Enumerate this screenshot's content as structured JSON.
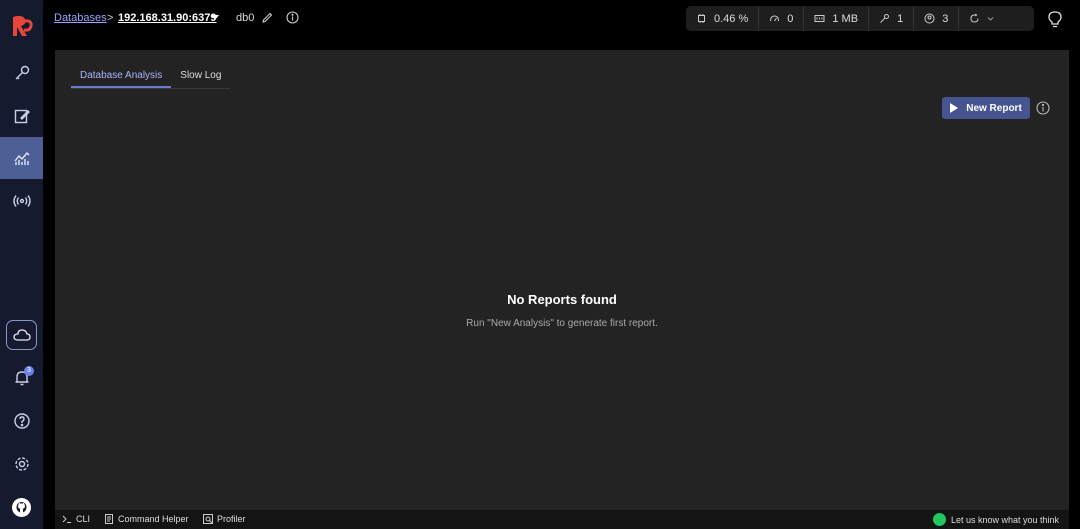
{
  "sidebar": {
    "logo": "redis-insight-logo",
    "items": [
      {
        "icon": "key-icon"
      },
      {
        "icon": "edit-icon"
      },
      {
        "icon": "analytics-icon",
        "active": true
      },
      {
        "icon": "pubsub-icon"
      }
    ],
    "notifications_count": "3"
  },
  "header": {
    "breadcrumb_link": "Databases",
    "breadcrumb_sep": ">",
    "host": "192.168.31.90:6379",
    "db": "db0",
    "stats": {
      "cpu": "0.46 %",
      "ops": "0",
      "memory": "1 MB",
      "keys": "1",
      "clients": "3"
    }
  },
  "tabs": [
    {
      "label": "Database Analysis",
      "active": true
    },
    {
      "label": "Slow Log",
      "active": false
    }
  ],
  "main": {
    "new_report_label": "New Report",
    "empty_title": "No Reports found",
    "empty_subtitle": "Run \"New Analysis\" to generate first report."
  },
  "footer": {
    "cli": "CLI",
    "command_helper": "Command Helper",
    "profiler": "Profiler",
    "feedback": "Let us know what you think"
  },
  "colors": {
    "accent": "#46548f",
    "sidebar_bg": "#161a2e",
    "active_nav": "#4d5f95",
    "panel_bg": "#232323"
  }
}
